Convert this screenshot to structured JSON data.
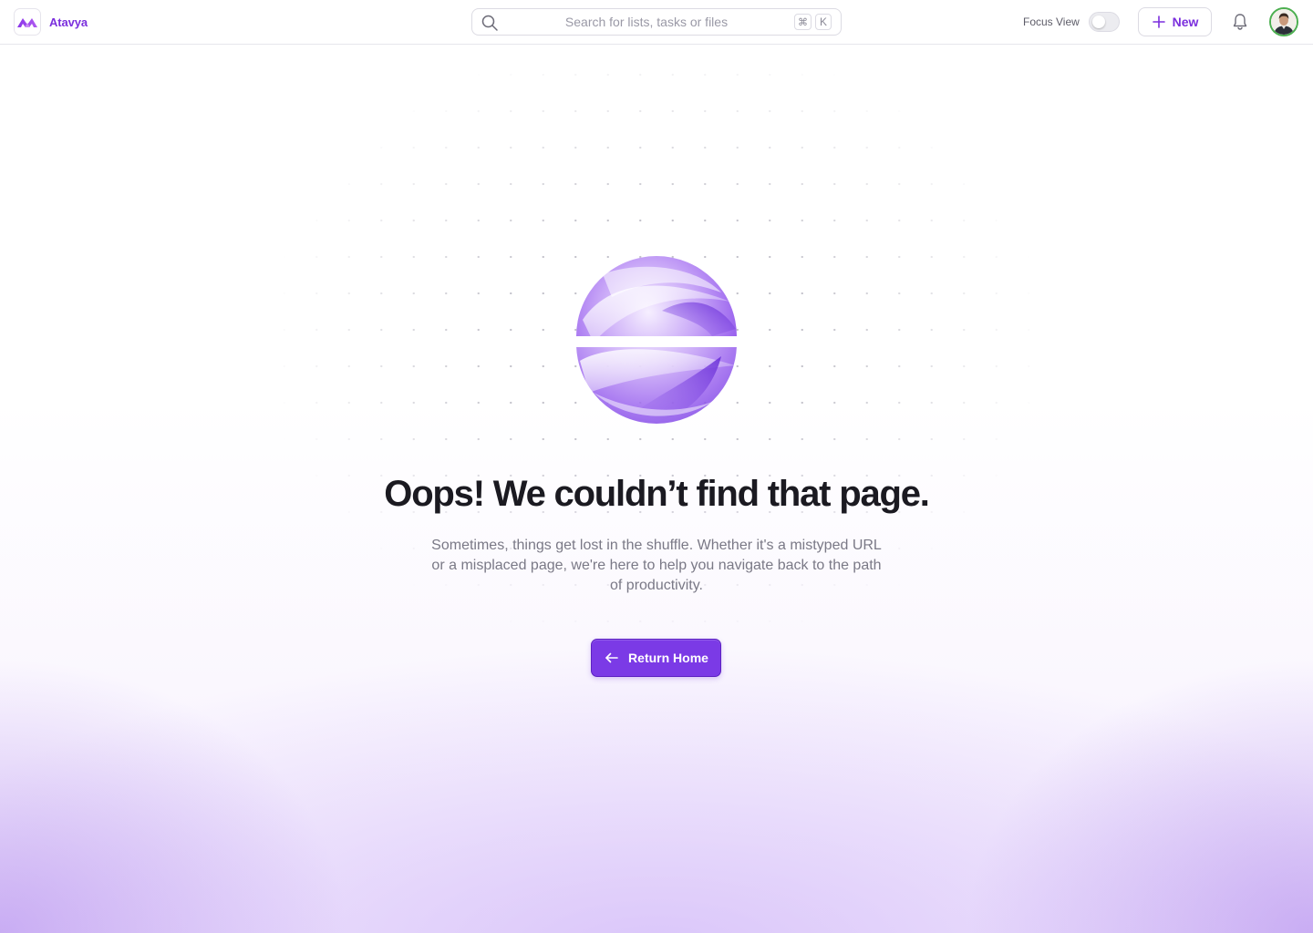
{
  "header": {
    "brand_name": "Atavya",
    "search": {
      "placeholder": "Search for lists, tasks or files",
      "shortcut_cmd": "⌘",
      "shortcut_key": "K"
    },
    "focus_view": {
      "label": "Focus View",
      "enabled": false
    },
    "new_button_label": "New"
  },
  "main": {
    "title": "Oops! We couldn’t find that page.",
    "description": "Sometimes, things get lost in the shuffle. Whether it's a mistyped URL or a misplaced page, we're here to help you navigate back to the path of productivity.",
    "return_button_label": "Return Home"
  },
  "colors": {
    "brand": "#7b2fdd",
    "button": "#7b3ae6",
    "title": "#1b1a21",
    "body_text": "#7a7986"
  },
  "icons": [
    "logo-mark-icon",
    "search-icon",
    "plus-icon",
    "bell-icon",
    "arrow-left-icon",
    "broken-orb-illustration"
  ]
}
